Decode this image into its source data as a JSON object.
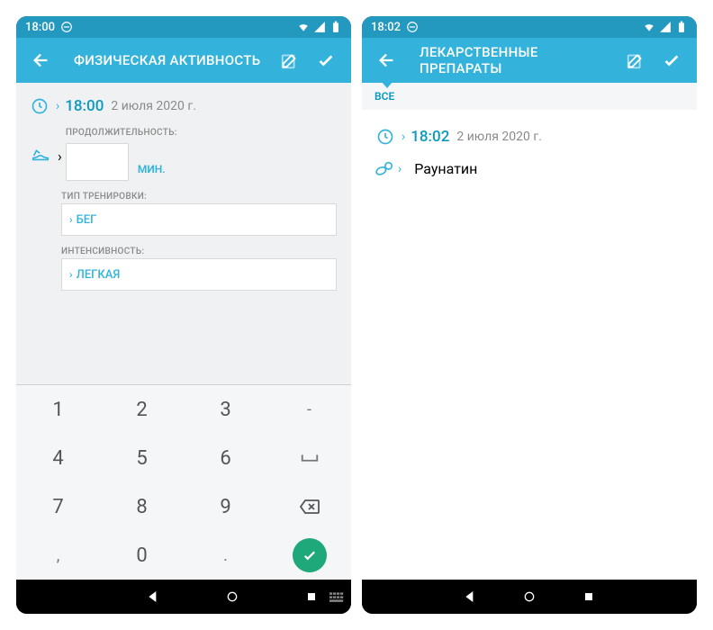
{
  "left": {
    "status_time": "18:00",
    "title": "ФИЗИЧЕСКАЯ АКТИВНОСТЬ",
    "time": "18:00",
    "date": "2 июля 2020 г.",
    "duration_label": "ПРОДОЛЖИТЕЛЬНОСТЬ:",
    "duration_value": "",
    "duration_unit": "МИН.",
    "type_label": "ТИП ТРЕНИРОВКИ:",
    "type_value": "БЕГ",
    "intensity_label": "ИНТЕНСИВНОСТЬ:",
    "intensity_value": "ЛЕГКАЯ",
    "keypad": [
      "1",
      "2",
      "3",
      "-",
      "4",
      "5",
      "6",
      "⎵",
      "7",
      "8",
      "9",
      "⌫",
      ",",
      "0",
      ".",
      "✓"
    ]
  },
  "right": {
    "status_time": "18:02",
    "title": "ЛЕКАРСТВЕННЫЕ ПРЕПАРАТЫ",
    "tab_all": "ВСЕ",
    "time": "18:02",
    "date": "2 июля 2020 г.",
    "drug_name": "Раунатин"
  }
}
